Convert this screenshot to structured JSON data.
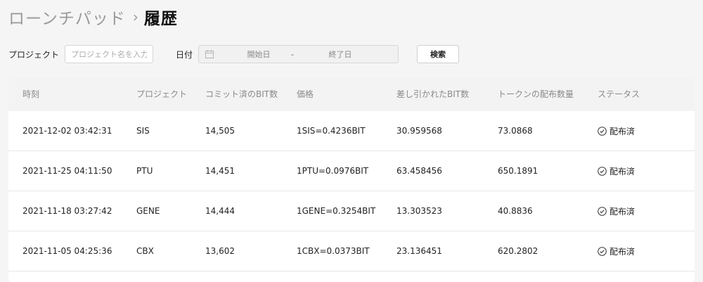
{
  "breadcrumb": {
    "parent": "ローンチパッド",
    "separator": "›",
    "current": "履歴"
  },
  "filters": {
    "project_label": "プロジェクト",
    "project_placeholder": "プロジェクト名を入力",
    "date_label": "日付",
    "date_start_placeholder": "開始日",
    "date_separator": "-",
    "date_end_placeholder": "終了日",
    "search_label": "検索"
  },
  "table": {
    "columns": [
      "時刻",
      "プロジェクト",
      "コミット済のBIT数",
      "価格",
      "差し引かれたBIT数",
      "トークンの配布数量",
      "ステータス"
    ],
    "rows": [
      {
        "time": "2021-12-02 03:42:31",
        "project": "SIS",
        "committed": "14,505",
        "price": "1SIS=0.4236BIT",
        "deducted": "30.959568",
        "distributed": "73.0868",
        "status": "配布済"
      },
      {
        "time": "2021-11-25 04:11:50",
        "project": "PTU",
        "committed": "14,451",
        "price": "1PTU=0.0976BIT",
        "deducted": "63.458456",
        "distributed": "650.1891",
        "status": "配布済"
      },
      {
        "time": "2021-11-18 03:27:42",
        "project": "GENE",
        "committed": "14,444",
        "price": "1GENE=0.3254BIT",
        "deducted": "13.303523",
        "distributed": "40.8836",
        "status": "配布済"
      },
      {
        "time": "2021-11-05 04:25:36",
        "project": "CBX",
        "committed": "13,602",
        "price": "1CBX=0.0373BIT",
        "deducted": "23.136451",
        "distributed": "620.2802",
        "status": "配布済"
      }
    ]
  },
  "icons": {
    "calendar": "calendar-icon",
    "status": "check-circle-icon",
    "separator": "chevron-right-icon"
  },
  "colors": {
    "background": "#f5f5f5",
    "header_row": "#f3f3f3",
    "muted_text": "#8a8a8a",
    "text": "#222222"
  }
}
